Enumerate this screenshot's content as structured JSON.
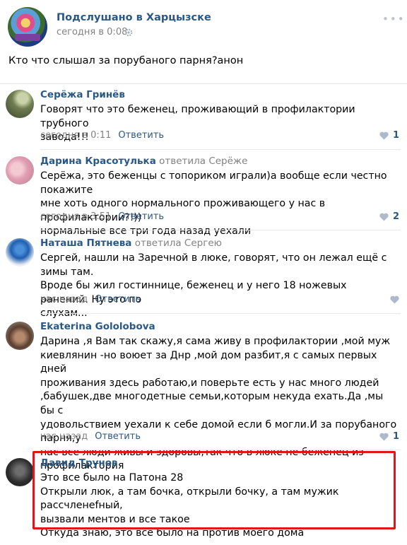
{
  "post": {
    "group_name": "Подслушано в Харцызске",
    "time": "сегодня в 0:08",
    "text": "Кто что слышал за порубаного парня?анон"
  },
  "comments": [
    {
      "author": "Серёжа Гринёв",
      "reply_to": "",
      "lines": [
        "Говорят что это беженец, проживающий в профилактории трубного",
        "завода!!!"
      ],
      "time": "сегодня в 0:11",
      "reply_label": "Ответить",
      "likes": "1"
    },
    {
      "author": "Дарина Красотулька",
      "reply_to": "ответила Серёже",
      "lines": [
        "Серёжа, это беженцы с топориком играли)а вообще если честно покажите",
        "мне хоть одного нормального проживающего у нас в профилактории?!))",
        "нормальные все три года назад уехали"
      ],
      "time": "сегодня в 3:51",
      "reply_label": "Ответить",
      "likes": "2"
    },
    {
      "author": "Наташа Пятнева",
      "reply_to": "ответила Сергею",
      "lines": [
        "Сергей, нашли на Заречной в люке, говорят, что он лежал ещё с зимы там.",
        "Вроде бы жил гостиннице, беженец и у него 18 ножевых ранений. Ну это по",
        "слухам..."
      ],
      "time": "час назад",
      "reply_label": "Ответить",
      "likes": ""
    },
    {
      "author": "Ekaterina Gololobova",
      "reply_to": "",
      "lines": [
        "Дарина ,я Вам так скажу,я сама живу в профилактории ,мой муж",
        "киевлянин -но воюет за Днр ,мой дом разбит,я с самых первых дней",
        "проживания здесь работаю,и поверьте есть у нас много людей",
        ",бабушек,две многодетные семьи,которым некуда ехать.Да ,мы бы с",
        "удовольствием уехали к себе домой если б могли.И за порубаного парня,у",
        "нас все люди живы и здоровы,так что в люке не беженец из",
        "профилактория"
      ],
      "time": "час назад",
      "reply_label": "Ответить",
      "likes": "1"
    },
    {
      "author": "Давид Трунов",
      "reply_to": "",
      "lines": [
        "Это все было на Патона 28",
        "Открыли люк, а там бочка, открыли бочку, а там мужик рассчленеfный,",
        "вызвали ментов и все такое",
        "Откуда знаю, это все было на против моего дома"
      ],
      "time": "",
      "reply_label": "",
      "likes": ""
    }
  ],
  "colors": {
    "link": "#2a5885",
    "meta": "#828282",
    "highlight": "#e0161b"
  }
}
